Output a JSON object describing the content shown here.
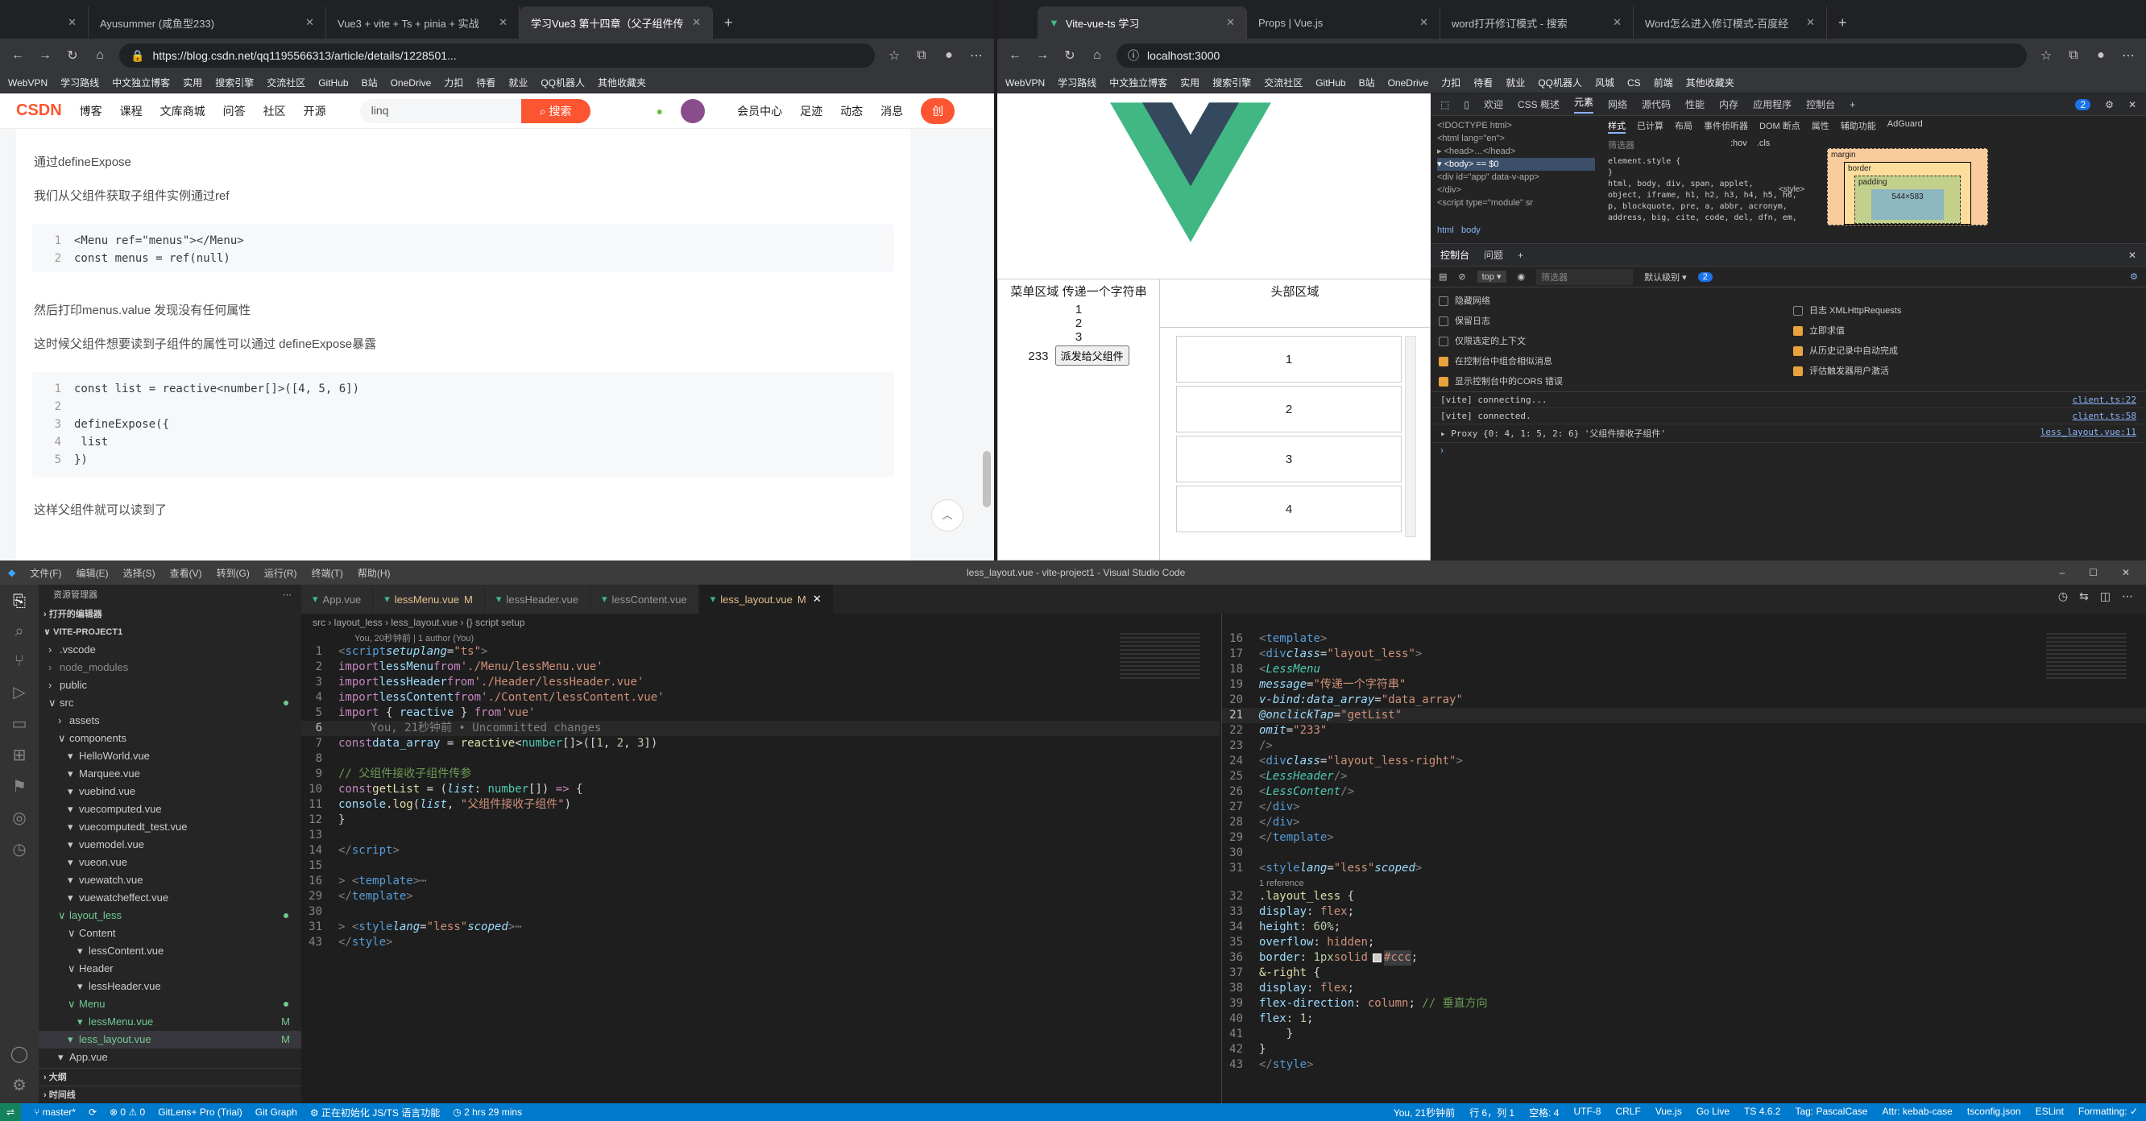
{
  "browser_left": {
    "tabs": [
      {
        "title": ""
      },
      {
        "title": "Ayusummer (咸鱼型233)"
      },
      {
        "title": "Vue3 + vite + Ts + pinia + 实战"
      },
      {
        "title": "学习Vue3 第十四章（父子组件传"
      }
    ],
    "url": "https://blog.csdn.net/qq1195566313/article/details/1228501...",
    "bookmarks": [
      "WebVPN",
      "学习路线",
      "中文独立博客",
      "实用",
      "搜索引擎",
      "交流社区",
      "GitHub",
      "B站",
      "OneDrive",
      "力扣",
      "待看",
      "就业",
      "QQ机器人",
      "其他收藏夹"
    ],
    "csdn_nav": [
      "博客",
      "课程",
      "文库商城",
      "问答",
      "社区",
      "开源"
    ],
    "csdn_search_value": "linq",
    "csdn_search_button": "搜索",
    "csdn_right": [
      "会员中心",
      "足迹",
      "动态",
      "消息"
    ],
    "csdn_create": "创",
    "article": {
      "p1": "通过defineExpose",
      "p2": "我们从父组件获取子组件实例通过ref",
      "code1": [
        "<Menu ref=\"menus\"></Menu>",
        "const menus = ref(null)"
      ],
      "p3": "然后打印menus.value 发现没有任何属性",
      "p4": "这时候父组件想要读到子组件的属性可以通过 defineExpose暴露",
      "code2": [
        "const list = reactive<number[]>([4, 5, 6])",
        "",
        "defineExpose({",
        "    list",
        "})"
      ],
      "p5": "这样父组件就可以读到了"
    }
  },
  "browser_right": {
    "tabs": [
      {
        "title": "Vite-vue-ts 学习"
      },
      {
        "title": "Props | Vue.js"
      },
      {
        "title": "word打开修订模式 - 搜索"
      },
      {
        "title": "Word怎么进入修订模式-百度经"
      }
    ],
    "url": "localhost:3000",
    "bookmarks": [
      "WebVPN",
      "学习路线",
      "中文独立博客",
      "实用",
      "搜索引擎",
      "交流社区",
      "GitHub",
      "B站",
      "OneDrive",
      "力扣",
      "待看",
      "就业",
      "QQ机器人",
      "风城",
      "CS",
      "前端",
      "其他收藏夹"
    ],
    "app": {
      "menu_title": "菜单区域 传递一个字符串",
      "menu_items": [
        "1",
        "2",
        "3"
      ],
      "omit_value": "233",
      "send_button": "派发给父组件",
      "header_title": "头部区域",
      "content_items": [
        "1",
        "2",
        "3",
        "4"
      ]
    }
  },
  "devtools": {
    "top_tabs": [
      "欢迎",
      "CSS 概述",
      "元素",
      "网络",
      "源代码",
      "性能",
      "内存",
      "应用程序",
      "控制台"
    ],
    "issues_count": "2",
    "dom_lines": [
      "<!DOCTYPE html>",
      "<html lang=\"en\">",
      "▸ <head>…</head>",
      "▾ <body> == $0",
      "  <div id=\"app\" data-v-app>",
      "  </div>",
      "  <script type=\"module\" sr"
    ],
    "crumbs": [
      "html",
      "body"
    ],
    "style_tabs": [
      "样式",
      "已计算",
      "布局",
      "事件侦听器",
      "DOM 断点",
      "属性",
      "辅助功能",
      "AdGuard"
    ],
    "filter_placeholder": "筛选器",
    "hov": ":hov",
    "cls": ".cls",
    "style_rules": [
      "element.style {",
      "}",
      "html, body, div, span, applet,",
      "object, iframe, h1, h2, h3, h4, h5, h6,",
      "p, blockquote, pre, a, abbr, acronym,",
      "address, big, cite, code, del, dfn, em,"
    ],
    "user_agent": "<style>",
    "box_labels": {
      "margin": "margin",
      "border": "border",
      "padding": "padding",
      "content": "544×583",
      "dash": "–"
    },
    "console_tabs": [
      "控制台",
      "问题"
    ],
    "console_context": "top",
    "console_filter": "筛选器",
    "console_level": "默认级别",
    "console_issues": "2",
    "settings_left": [
      {
        "label": "隐藏网络",
        "checked": false
      },
      {
        "label": "保留日志",
        "checked": false
      },
      {
        "label": "仅限选定的上下文",
        "checked": false
      },
      {
        "label": "在控制台中组合相似消息",
        "checked": true
      },
      {
        "label": "显示控制台中的CORS 错误",
        "checked": true
      }
    ],
    "settings_right": [
      {
        "label": "日志 XMLHttpRequests",
        "checked": false
      },
      {
        "label": "立即求值",
        "checked": true
      },
      {
        "label": "从历史记录中自动完成",
        "checked": true
      },
      {
        "label": "评估触发器用户激活",
        "checked": true
      }
    ],
    "logs": [
      {
        "text": "[vite] connecting...",
        "src": "client.ts:22"
      },
      {
        "text": "[vite] connected.",
        "src": "client.ts:58"
      },
      {
        "text": "▸ Proxy {0: 4, 1: 5, 2: 6} '父组件接收子组件'",
        "src": "less_layout.vue:11"
      }
    ],
    "prompt": "›"
  },
  "vscode": {
    "menu": [
      "文件(F)",
      "编辑(E)",
      "选择(S)",
      "查看(V)",
      "转到(G)",
      "运行(R)",
      "终端(T)",
      "帮助(H)"
    ],
    "title": "less_layout.vue - vite-project1 - Visual Studio Code",
    "explorer_title": "资源管理器",
    "open_editors": "打开的编辑器",
    "project": "VITE-PROJECT1",
    "tree": [
      {
        "name": ".vscode",
        "level": 1,
        "arrow": "›",
        "color": "#ccc"
      },
      {
        "name": "node_modules",
        "level": 1,
        "arrow": "›",
        "color": "#8b8b8b"
      },
      {
        "name": "public",
        "level": 1,
        "arrow": "›",
        "color": "#ccc"
      },
      {
        "name": "src",
        "level": 1,
        "arrow": "∨",
        "color": "#ccc",
        "dot": true
      },
      {
        "name": "assets",
        "level": 2,
        "arrow": "›",
        "color": "#ccc"
      },
      {
        "name": "components",
        "level": 2,
        "arrow": "∨",
        "color": "#ccc"
      },
      {
        "name": "HelloWorld.vue",
        "level": 3,
        "arrow": "▾",
        "color": "#ccc"
      },
      {
        "name": "Marquee.vue",
        "level": 3,
        "arrow": "▾",
        "color": "#ccc"
      },
      {
        "name": "vuebind.vue",
        "level": 3,
        "arrow": "▾",
        "color": "#ccc"
      },
      {
        "name": "vuecomputed.vue",
        "level": 3,
        "arrow": "▾",
        "color": "#ccc"
      },
      {
        "name": "vuecomputedt_test.vue",
        "level": 3,
        "arrow": "▾",
        "color": "#ccc"
      },
      {
        "name": "vuemodel.vue",
        "level": 3,
        "arrow": "▾",
        "color": "#ccc"
      },
      {
        "name": "vueon.vue",
        "level": 3,
        "arrow": "▾",
        "color": "#ccc"
      },
      {
        "name": "vuewatch.vue",
        "level": 3,
        "arrow": "▾",
        "color": "#ccc"
      },
      {
        "name": "vuewatcheffect.vue",
        "level": 3,
        "arrow": "▾",
        "color": "#ccc"
      },
      {
        "name": "layout_less",
        "level": 2,
        "arrow": "∨",
        "color": "#73c991",
        "dot": true
      },
      {
        "name": "Content",
        "level": 3,
        "arrow": "∨",
        "color": "#ccc"
      },
      {
        "name": "lessContent.vue",
        "level": 4,
        "arrow": "▾",
        "color": "#ccc"
      },
      {
        "name": "Header",
        "level": 3,
        "arrow": "∨",
        "color": "#ccc"
      },
      {
        "name": "lessHeader.vue",
        "level": 4,
        "arrow": "▾",
        "color": "#ccc"
      },
      {
        "name": "Menu",
        "level": 3,
        "arrow": "∨",
        "color": "#73c991",
        "dot": true
      },
      {
        "name": "lessMenu.vue",
        "level": 4,
        "arrow": "▾",
        "color": "#73c991",
        "badge": "M"
      },
      {
        "name": "less_layout.vue",
        "level": 3,
        "arrow": "▾",
        "color": "#73c991",
        "badge": "M",
        "selected": true
      },
      {
        "name": "App.vue",
        "level": 2,
        "arrow": "▾",
        "color": "#ccc"
      }
    ],
    "outline": "大纲",
    "timeline": "时间线",
    "tabs": [
      {
        "name": "App.vue",
        "badge": ""
      },
      {
        "name": "lessMenu.vue",
        "badge": "M"
      },
      {
        "name": "lessHeader.vue",
        "badge": ""
      },
      {
        "name": "lessContent.vue",
        "badge": ""
      },
      {
        "name": "less_layout.vue",
        "badge": "M",
        "active": true
      }
    ],
    "breadcrumb": [
      "src",
      "layout_less",
      "less_layout.vue",
      "{} script setup"
    ],
    "blame": "You, 20秒钟前 | 1 author (You)",
    "uncommitted": "You, 21秒钟前 • Uncommitted changes",
    "reference": "1 reference",
    "status": {
      "branch": "master*",
      "sync": "⟳",
      "problems": "⊗ 0 ⚠ 0",
      "gitlens": "GitLens+ Pro (Trial)",
      "gitgraph": "Git Graph",
      "init": "正在初始化 JS/TS 语言功能",
      "time": "2 hrs 29 mins",
      "right": [
        "You, 21秒钟前",
        "行 6，列 1",
        "空格: 4",
        "UTF-8",
        "CRLF",
        "Vue.js",
        "Go Live",
        "TS 4.6.2",
        "Tag: PascalCase",
        "Attr: kebab-case",
        "tsconfig.json",
        "ESLint",
        "Formatting: ✓"
      ]
    }
  }
}
